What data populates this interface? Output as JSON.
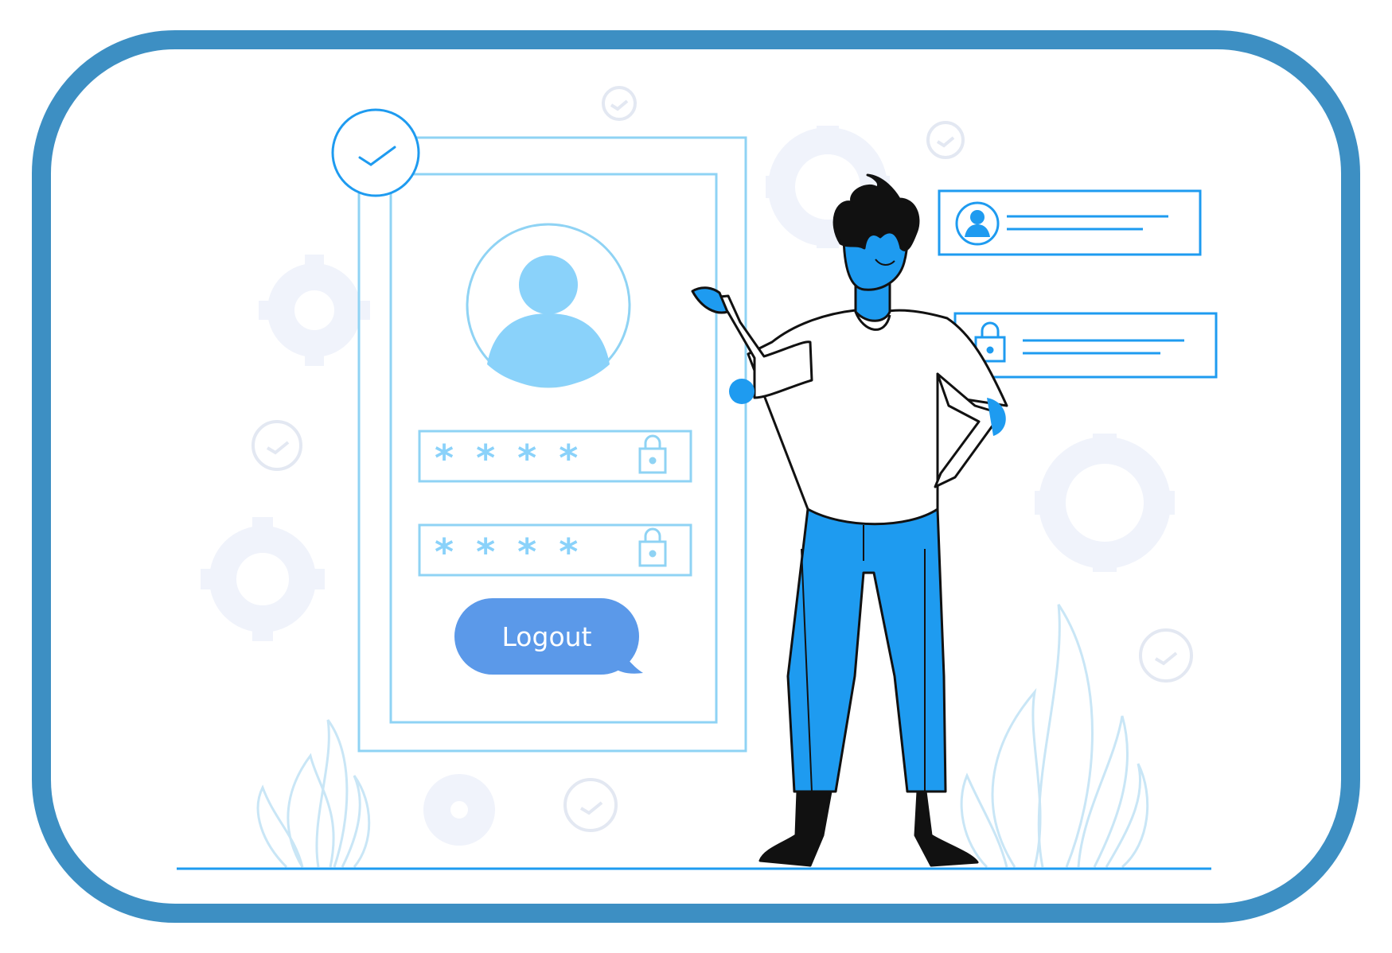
{
  "illustration": {
    "logout_label": "Logout",
    "password_mask": "* * * *",
    "colors": {
      "frame": "#3d8fc3",
      "accent": "#1e9bf0",
      "outline": "#8fd3f4",
      "button": "#5b99e9",
      "avatar": "#8ad2fa"
    },
    "icons": [
      "check-circle-icon",
      "user-avatar-icon",
      "lock-icon",
      "gear-icon",
      "plant-icon"
    ]
  }
}
